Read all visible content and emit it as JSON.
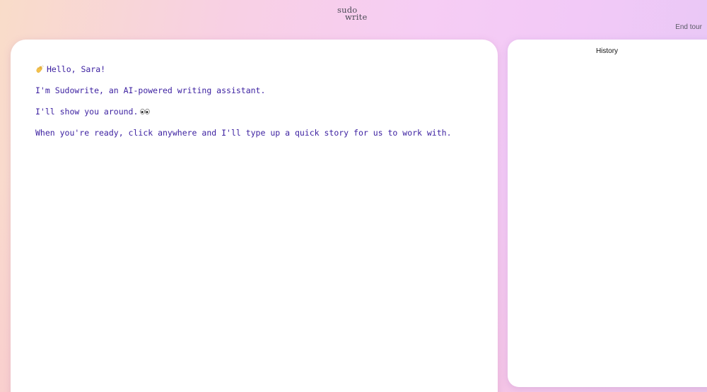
{
  "header": {
    "logo_line1": "sudo",
    "logo_line2": "write",
    "end_tour_label": "End tour"
  },
  "editor": {
    "icons": {
      "greeting": "waving-hand-icon",
      "tour": "eyes-icon"
    },
    "greeting": "Hello, Sara!",
    "intro": "I'm Sudowrite, an AI-powered writing assistant.",
    "tour_line": "I'll show you around.",
    "prompt": "When you're ready, click anywhere and I'll type up a quick story for us to work with.",
    "text_color": "#3b1fa0"
  },
  "history": {
    "title": "History"
  }
}
